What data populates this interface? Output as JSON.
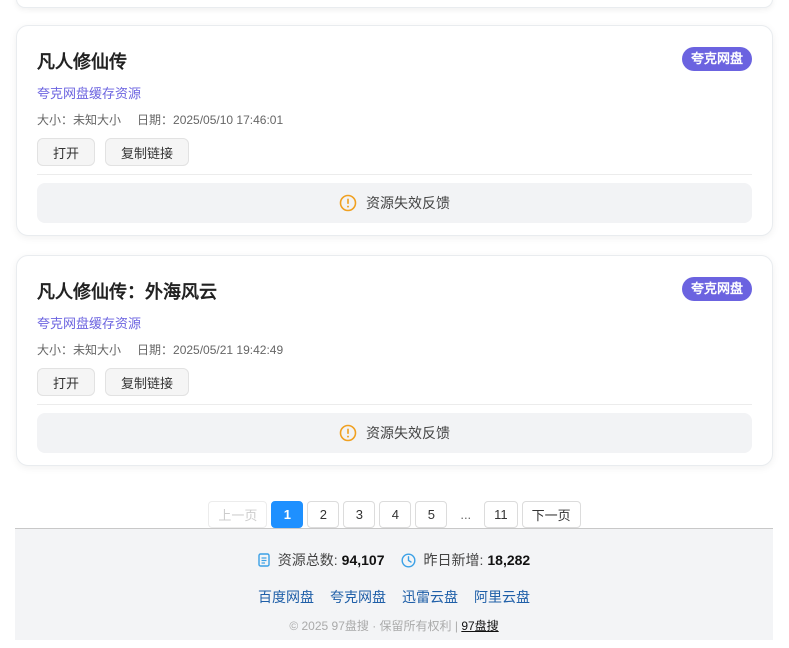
{
  "cards": [
    {
      "title": "凡人修仙传",
      "badge": "夸克网盘",
      "source": "夸克网盘缓存资源",
      "size": "大小：未知大小",
      "date": "日期：2025/05/10 17:46:01",
      "open_label": "打开",
      "copy_label": "复制链接",
      "feedback_label": "资源失效反馈"
    },
    {
      "title": "凡人修仙传：外海风云",
      "badge": "夸克网盘",
      "source": "夸克网盘缓存资源",
      "size": "大小：未知大小",
      "date": "日期：2025/05/21 19:42:49",
      "open_label": "打开",
      "copy_label": "复制链接",
      "feedback_label": "资源失效反馈"
    }
  ],
  "pagination": {
    "prev": "上一页",
    "pages": [
      "1",
      "2",
      "3",
      "4",
      "5"
    ],
    "ellipsis": "...",
    "last": "11",
    "next": "下一页",
    "current": "1"
  },
  "footer": {
    "total_label": "资源总数:",
    "total_value": "94,107",
    "new_label": "昨日新增:",
    "new_value": "18,282",
    "links": [
      "百度网盘",
      "夸克网盘",
      "迅雷云盘",
      "阿里云盘"
    ],
    "copyright": "© 2025 97盘搜 · 保留所有权利 |",
    "site_link": "97盘搜"
  },
  "colors": {
    "badge": "#6b63e0",
    "accent": "#1e90ff",
    "warn": "#f0a020",
    "link": "#1f5fa8"
  },
  "icons": {
    "feedback": "warning-circle-icon",
    "total": "document-icon",
    "new": "clock-icon"
  }
}
